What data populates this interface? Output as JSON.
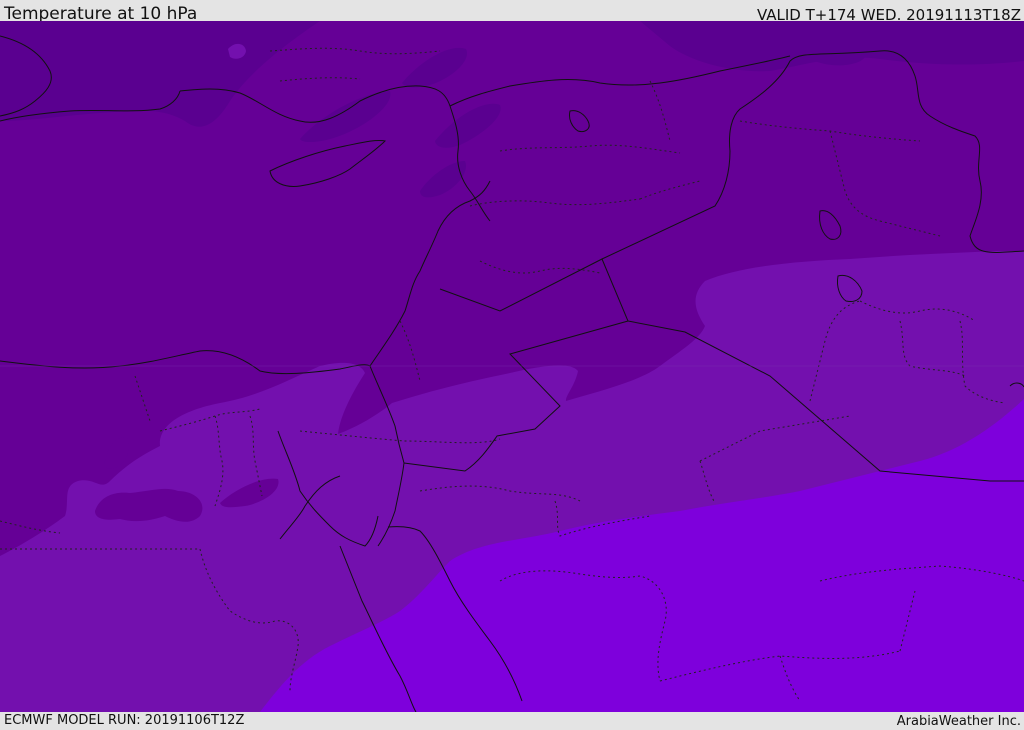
{
  "header": {
    "title": "Temperature at 10 hPa",
    "valid": "VALID T+174 WED. 20191113T18Z"
  },
  "footer": {
    "model_run": "ECMWF MODEL RUN: 20191106T12Z",
    "credit": "ArabiaWeather Inc."
  },
  "map": {
    "variable": "temperature",
    "level": "10 hPa",
    "colors": {
      "zone_darkest": "#5a0090",
      "zone_dark": "#650096",
      "zone_mid": "#7310ae",
      "zone_light": "#7e00dc",
      "border_line": "#111111"
    }
  }
}
